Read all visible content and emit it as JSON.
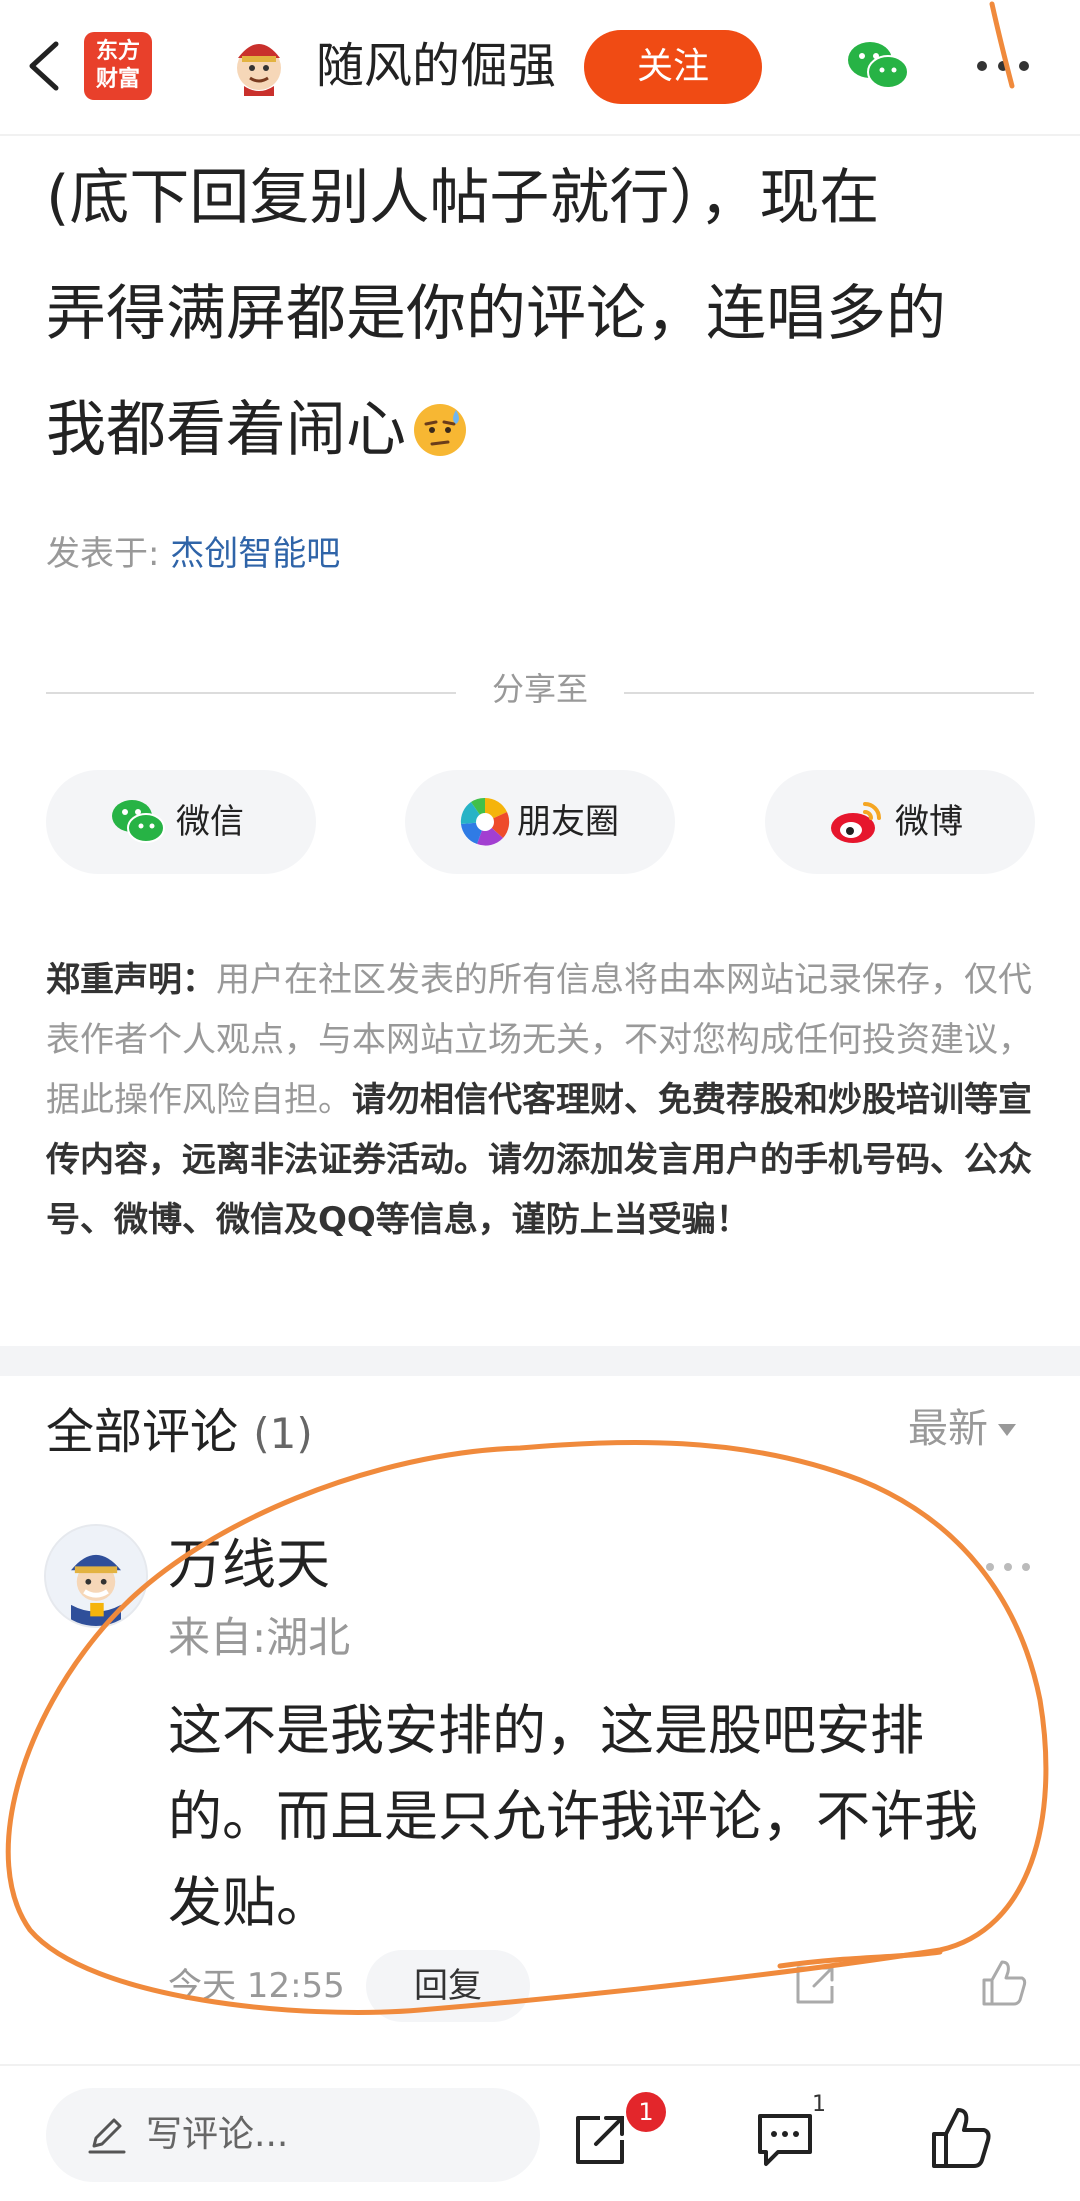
{
  "header": {
    "brand_line1": "东方",
    "brand_line2": "财富",
    "author_name": "随风的倔强",
    "follow_label": "关注"
  },
  "post": {
    "lines": [
      "(底下回复别人帖子就行），现在",
      "弄得满屏都是你的评论，连唱多的",
      "我都看着闹心"
    ],
    "posted_in_label": "发表于: ",
    "forum_name": "杰创智能吧"
  },
  "share": {
    "title": "分享至",
    "wechat_label": "微信",
    "moments_label": "朋友圈",
    "weibo_label": "微博"
  },
  "disclaimer": {
    "heading": "郑重声明：",
    "gray_text": "用户在社区发表的所有信息将由本网站记录保存，仅代表作者个人观点，与本网站立场无关，不对您构成任何投资建议，据此操作风险自担。",
    "bold_text": "请勿相信代客理财、免费荐股和炒股培训等宣传内容，远离非法证券活动。请勿添加发言用户的手机号码、公众号、微博、微信及QQ等信息，谨防上当受骗！"
  },
  "comments": {
    "title": "全部评论",
    "count": "(1)",
    "sort_label": "最新",
    "items": [
      {
        "user": "万线天",
        "location": "来自:湖北",
        "text_lines": [
          "这不是我安排的，这是股吧安排",
          "的。而且是只允许我评论，不许我",
          "发贴。"
        ],
        "time": "今天 12:55",
        "reply_label": "回复"
      }
    ]
  },
  "bottom_bar": {
    "write_placeholder": "写评论...",
    "share_badge": "1",
    "comment_count": "1"
  },
  "colors": {
    "follow_button": "#f04b14",
    "brand_red": "#e8402b",
    "forum_link": "#2f64a8",
    "annotation_orange": "#f08a3c"
  }
}
